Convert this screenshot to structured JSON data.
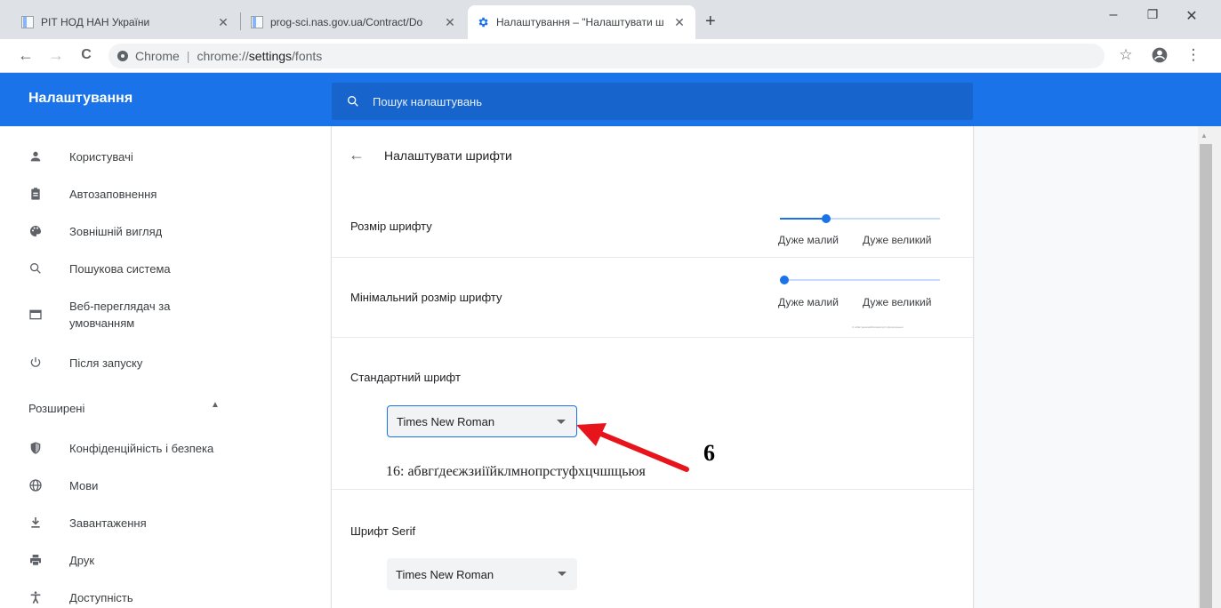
{
  "tabs": [
    {
      "title": "РІТ НОД НАН України",
      "active": false
    },
    {
      "title": "prog-sci.nas.gov.ua/Contract/Do",
      "active": false
    },
    {
      "title": "Налаштування – \"Налаштувати ш",
      "active": true
    }
  ],
  "tab_close_glyph": "✕",
  "newtab_glyph": "+",
  "window_controls": {
    "minimize": "–",
    "restore": "❐",
    "close": "✕"
  },
  "toolbar": {
    "back": "←",
    "forward": "→",
    "reload": "C",
    "scheme_label": "Chrome",
    "divider": "|",
    "url_host": "chrome://",
    "url_path": "settings",
    "url_rest": "/fonts",
    "star": "☆",
    "menu": "⋮"
  },
  "header": {
    "app_title": "Налаштування",
    "search_placeholder": "Пошук налаштувань"
  },
  "sidebar": {
    "items": [
      {
        "label": "Користувачі",
        "icon": "person-icon"
      },
      {
        "label": "Автозаповнення",
        "icon": "clipboard-icon"
      },
      {
        "label": "Зовнішній вигляд",
        "icon": "palette-icon"
      },
      {
        "label": "Пошукова система",
        "icon": "search-icon"
      },
      {
        "label": "Веб-переглядач за умовчанням",
        "icon": "browser-icon"
      },
      {
        "label": "Після запуску",
        "icon": "power-icon"
      }
    ],
    "advanced_label": "Розширені",
    "advanced_caret": "▲",
    "advanced_items": [
      {
        "label": "Конфіденційність і безпека",
        "icon": "shield-icon"
      },
      {
        "label": "Мови",
        "icon": "globe-icon"
      },
      {
        "label": "Завантаження",
        "icon": "download-icon"
      },
      {
        "label": "Друк",
        "icon": "print-icon"
      },
      {
        "label": "Доступність",
        "icon": "accessibility-icon"
      }
    ]
  },
  "main": {
    "back_glyph": "←",
    "subpage_title": "Налаштувати шрифти",
    "font_size": {
      "label": "Розмір шрифту",
      "min_label": "Дуже малий",
      "max_label": "Дуже великий",
      "value_fraction": 0.29
    },
    "min_font_size": {
      "label": "Мінімальний розмір шрифту",
      "min_label": "Дуже малий",
      "max_label": "Дуже великий",
      "value_fraction": 0.03,
      "sample": "0: абвгґдеєжзиіїйклмнопрстуфхцчшщьюя"
    },
    "standard_font": {
      "label": "Стандартний шрифт",
      "value": "Times New Roman",
      "sample": "16: абвгґдеєжзиіїйклмнопрстуфхцчшщьюя"
    },
    "serif_font": {
      "label": "Шрифт Serif",
      "value": "Times New Roman"
    }
  },
  "annotation": {
    "number": "6",
    "color": "#e8141b"
  },
  "colors": {
    "header_blue": "#1a73e8",
    "search_blue": "#1765cc",
    "accent": "#1a73e8"
  }
}
